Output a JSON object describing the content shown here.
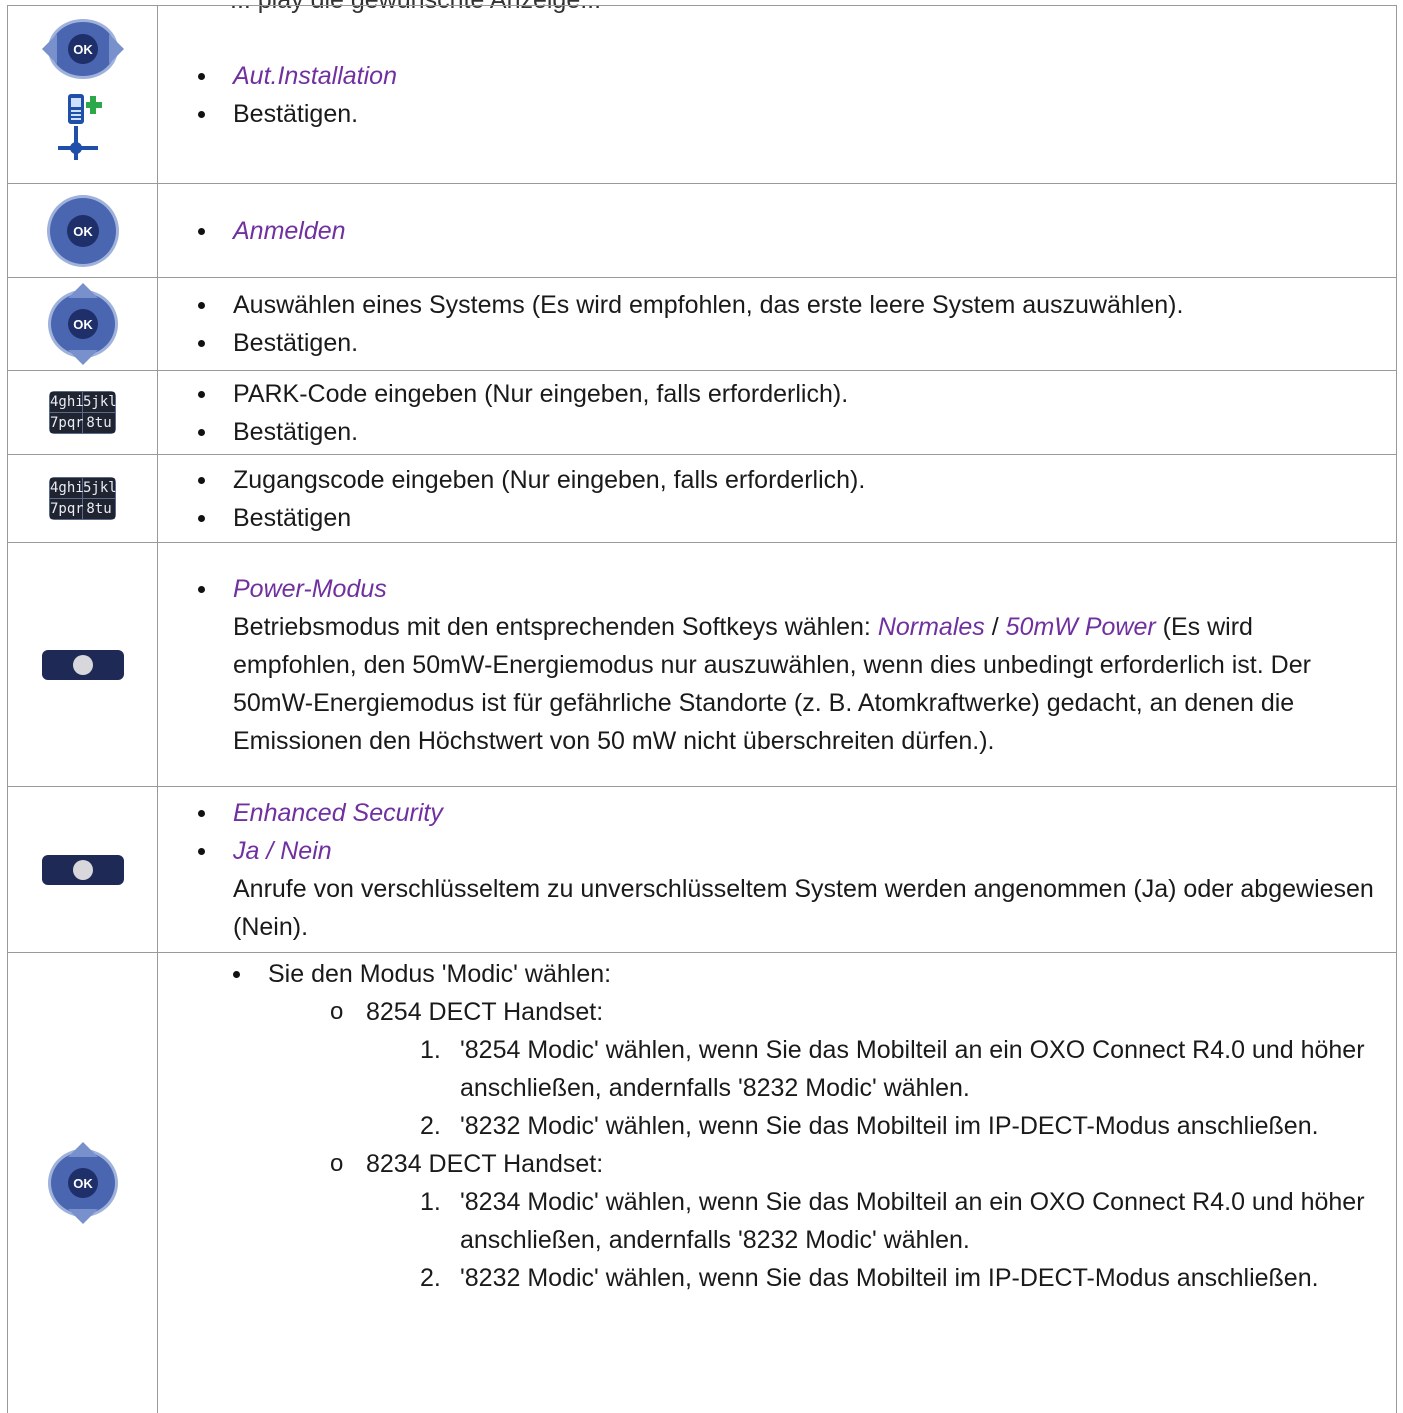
{
  "header": {
    "fragment": "... play die gewünschte Anzeige..."
  },
  "rows": [
    {
      "icons": [
        "navigator-ok-left-right-icon",
        "handset-settings-icon"
      ],
      "items": [
        {
          "text": "Aut.Installation",
          "italic": true
        },
        {
          "text": "Bestätigen.",
          "italic": false
        }
      ]
    },
    {
      "icons": [
        "ok-button-icon"
      ],
      "items": [
        {
          "text": "Anmelden",
          "italic": true
        }
      ]
    },
    {
      "icons": [
        "navigator-ok-up-down-icon"
      ],
      "items": [
        {
          "text": "Auswählen eines Systems (Es wird empfohlen, das erste leere System auszuwählen).",
          "italic": false
        },
        {
          "text": "Bestätigen.",
          "italic": false
        }
      ]
    },
    {
      "icons": [
        "keypad-icon"
      ],
      "keypad": [
        "4ghi",
        "5jkl",
        "7pqr",
        "8tu"
      ],
      "items": [
        {
          "text": "PARK-Code eingeben (Nur eingeben, falls erforderlich).",
          "italic": false
        },
        {
          "text": "Bestätigen.",
          "italic": false
        }
      ]
    },
    {
      "icons": [
        "keypad-icon"
      ],
      "keypad": [
        "4ghi",
        "5jkl",
        "7pqr",
        "8tu"
      ],
      "items": [
        {
          "text": "Zugangscode eingeben (Nur eingeben, falls erforderlich).",
          "italic": false
        },
        {
          "text": "Bestätigen",
          "italic": false
        }
      ]
    },
    {
      "icons": [
        "softkey-icon"
      ],
      "items": [
        {
          "text": "Power-Modus",
          "italic": true
        }
      ],
      "para": {
        "p1": "Betriebsmodus mit den entsprechenden Softkeys wählen: ",
        "opt1": "Normales",
        "sep": " / ",
        "opt2": "50mW Power",
        "p2": " (Es wird empfohlen, den 50mW-Energiemodus nur auszuwählen, wenn dies unbedingt erforderlich ist. Der 50mW-Energiemodus ist für gefährliche Standorte (z. B. Atomkraftwerke) gedacht, an denen die Emissionen den Höchstwert von 50 mW nicht überschreiten dürfen.)."
      }
    },
    {
      "icons": [
        "softkey-icon"
      ],
      "items": [
        {
          "text": "Enhanced Security",
          "italic": true
        },
        {
          "text": "Ja / Nein",
          "italic": true
        }
      ],
      "para": "Anrufe von verschlüsseltem zu unverschlüsseltem System werden angenommen (Ja) oder abgewiesen (Nein)."
    },
    {
      "icons": [
        "navigator-ok-up-down-icon"
      ],
      "lead": "Sie den Modus 'Modic' wählen:",
      "groups": [
        {
          "title": "8254 DECT Handset:",
          "steps": [
            {
              "n": "1.",
              "text": "'8254 Modic' wählen, wenn Sie das Mobilteil an ein OXO Connect R4.0 und höher anschließen, andernfalls '8232 Modic' wählen."
            },
            {
              "n": "2.",
              "text": "'8232 Modic' wählen, wenn Sie das Mobilteil im IP-DECT-Modus anschließen."
            }
          ]
        },
        {
          "title": "8234 DECT Handset:",
          "steps": [
            {
              "n": "1.",
              "text": "'8234 Modic' wählen, wenn Sie das Mobilteil an ein OXO Connect R4.0 und höher anschließen, andernfalls '8232 Modic' wählen."
            },
            {
              "n": "2.",
              "text": "'8232 Modic' wählen, wenn Sie das Mobilteil im IP-DECT-Modus anschließen."
            }
          ]
        }
      ]
    }
  ],
  "colors": {
    "italic_accent": "#7030a0",
    "border": "#9a9a9a",
    "navigator_blue": "#3a5aa8"
  }
}
